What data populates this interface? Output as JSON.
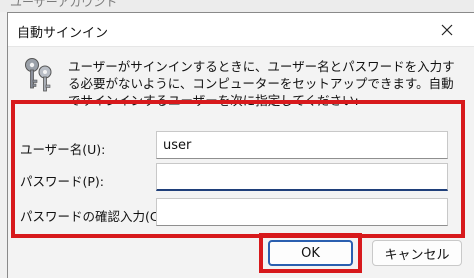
{
  "parent_window": {
    "title": "ユーザーアカウント"
  },
  "dialog": {
    "title": "自動サインイン",
    "close_glyph": "✕",
    "message": "ユーザーがサインインするときに、ユーザー名とパスワードを入力する必要がないように、コンピューターをセットアップできます。自動でサインインするユーザーを次に指定してください:",
    "fields": [
      {
        "label": "ユーザー名(U):",
        "value": "user"
      },
      {
        "label": "パスワード(P):",
        "value": ""
      },
      {
        "label": "パスワードの確認入力(C):",
        "value": ""
      }
    ],
    "buttons": {
      "ok": "OK",
      "cancel": "キャンセル"
    }
  },
  "colors": {
    "highlight": "#d7191c",
    "focus_underline": "#1f3f7a",
    "default_button_border": "#2a5fb0",
    "key_icon": "#8a8f9a"
  },
  "icons": [
    "keys-icon",
    "close-icon"
  ]
}
